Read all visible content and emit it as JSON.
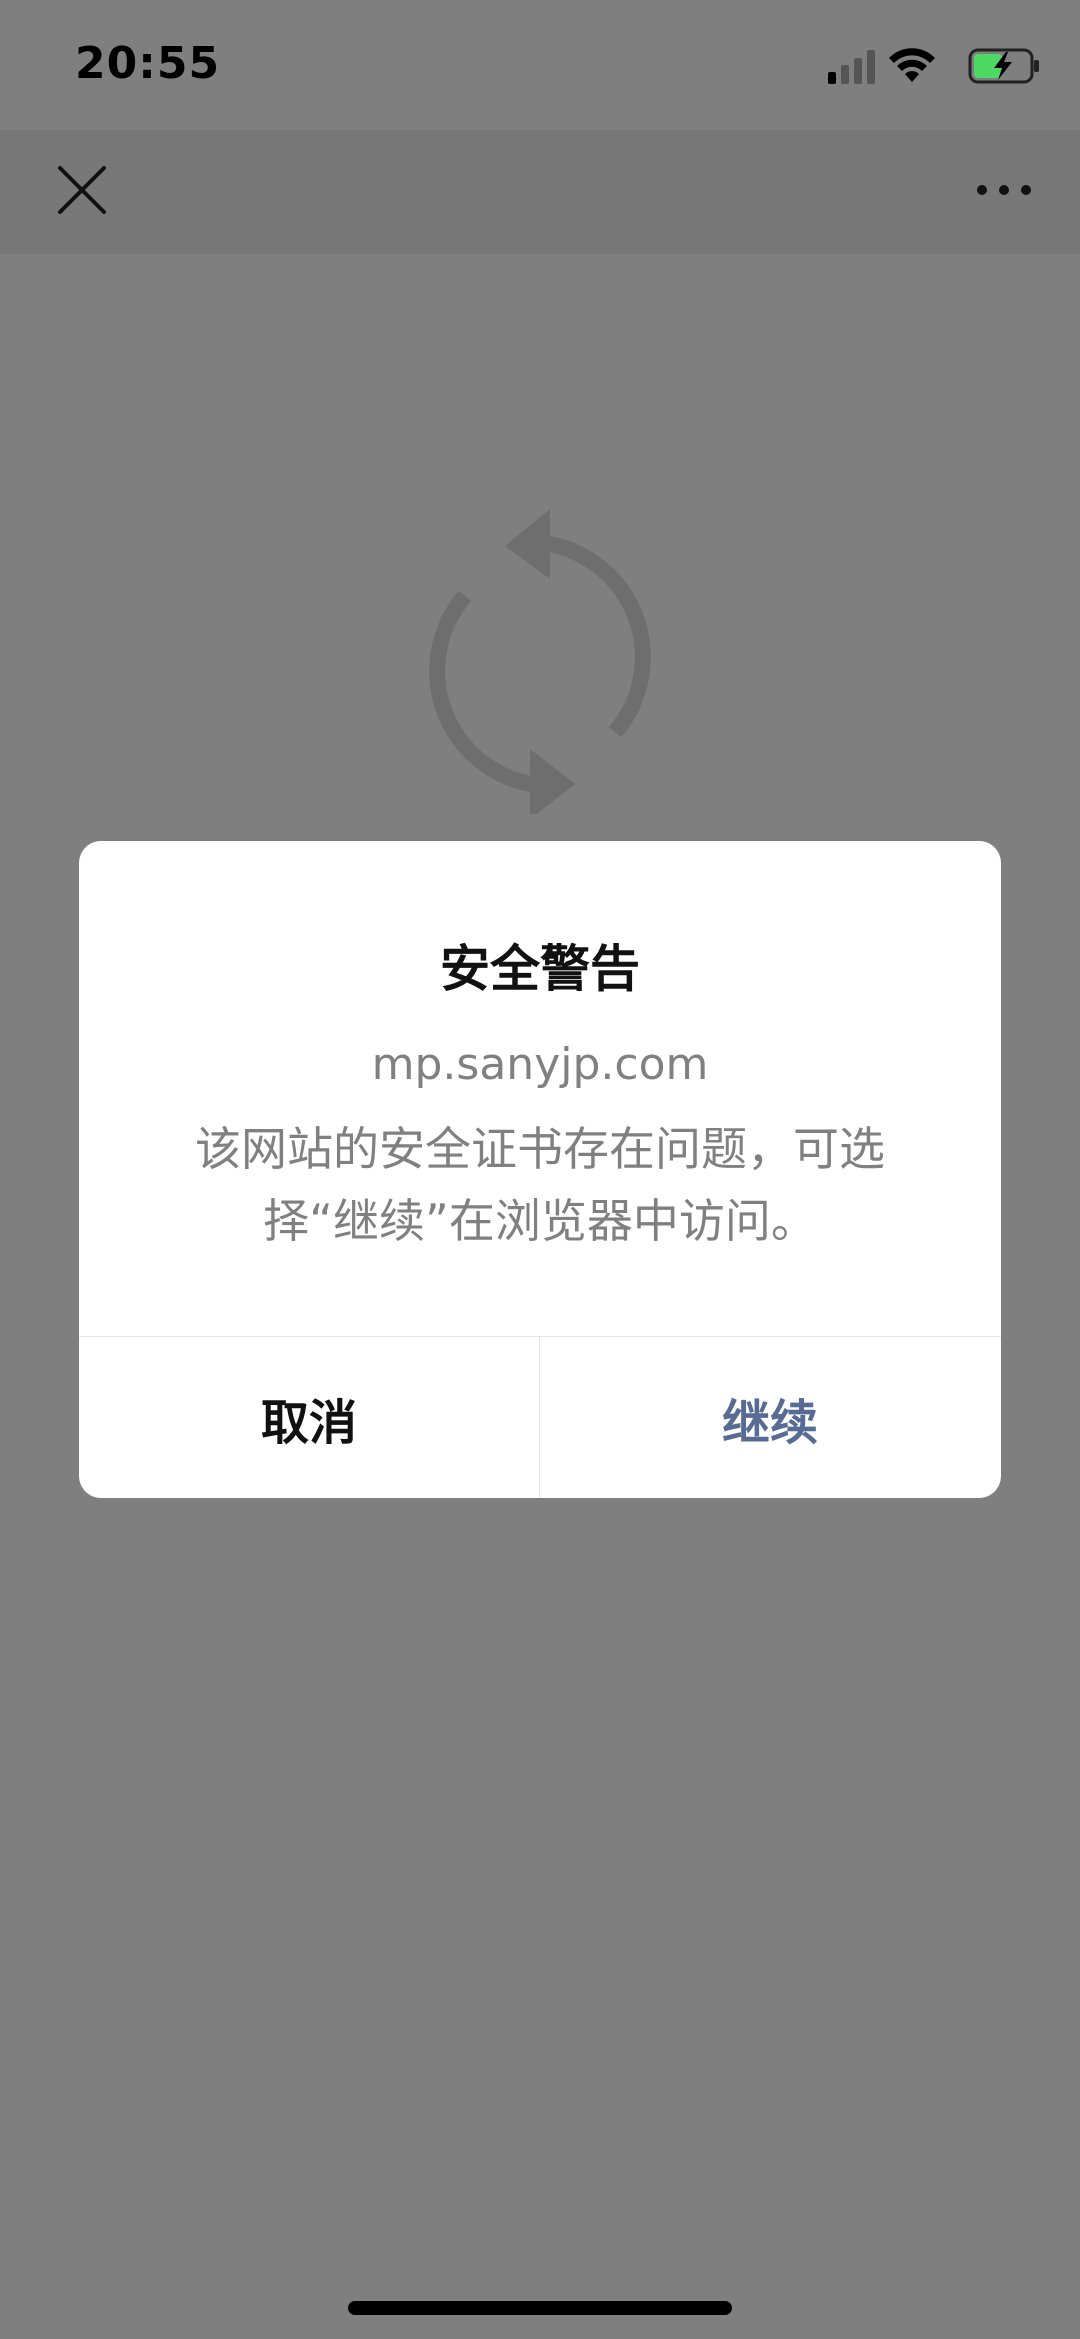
{
  "status_bar": {
    "time": "20:55",
    "icons": [
      "signal-icon",
      "wifi-icon",
      "battery-charging-icon"
    ]
  },
  "nav_bar": {
    "close_icon": "close-icon",
    "more_icon": "more-icon"
  },
  "content": {
    "loading_icon": "reload-icon"
  },
  "dialog": {
    "title": "安全警告",
    "url": "mp.sanyjp.com",
    "message": "该网站的安全证书存在问题，可选择“继续”在浏览器中访问。",
    "cancel_label": "取消",
    "continue_label": "继续"
  },
  "colors": {
    "overlay": "#7f7f7f",
    "accent": "#576b95",
    "battery": "#4cd964"
  }
}
